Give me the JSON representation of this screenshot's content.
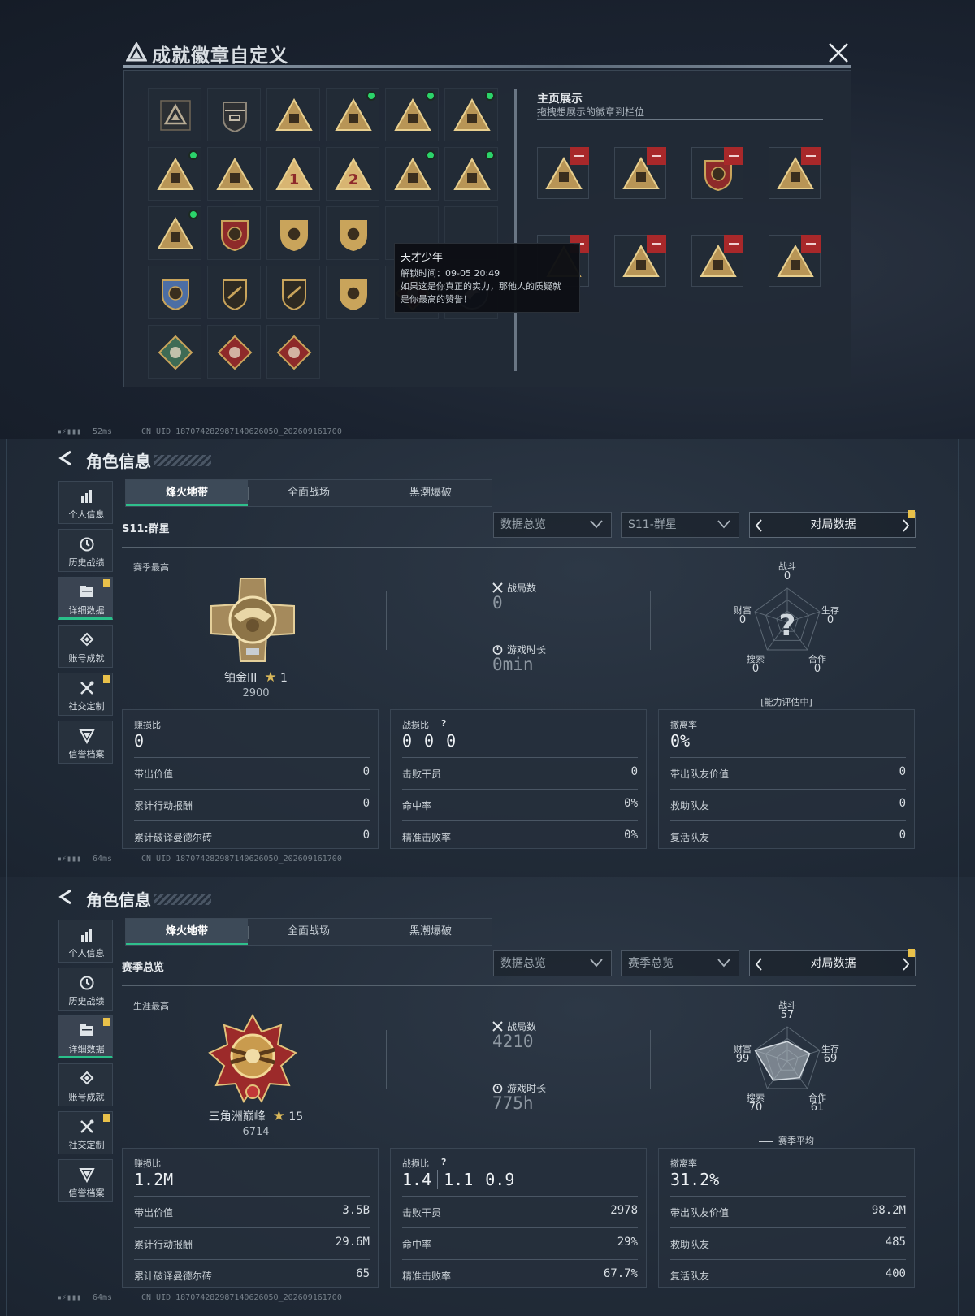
{
  "badge_dialog": {
    "title": "成就徽章自定义",
    "homepage_title": "主页展示",
    "homepage_subtitle": "拖拽想展示的徽章到栏位",
    "badges": [
      {
        "icon": "triangle-logo-icon",
        "new": false
      },
      {
        "icon": "helicopter-badge-icon",
        "new": false
      },
      {
        "icon": "tower-badge-icon",
        "new": false
      },
      {
        "icon": "number-58-badge-icon",
        "new": true
      },
      {
        "icon": "tank-badge-icon",
        "new": true
      },
      {
        "icon": "soldier-badge-icon",
        "new": true
      },
      {
        "icon": "globe-badge-icon",
        "new": true
      },
      {
        "icon": "ship-badge-icon",
        "new": false
      },
      {
        "icon": "number-1-badge-icon",
        "new": false
      },
      {
        "icon": "number-2-badge-icon",
        "new": false
      },
      {
        "icon": "building-badge-icon",
        "new": true
      },
      {
        "icon": "shield-badge-icon",
        "new": true
      },
      {
        "icon": "hands-badge-icon",
        "new": true
      },
      {
        "icon": "star-wreath-badge-icon",
        "new": false
      },
      {
        "icon": "shield-emblem-icon",
        "new": false
      },
      {
        "icon": "tall-crest-icon",
        "new": false
      },
      {
        "icon": "tooltip-hidden",
        "new": false
      },
      {
        "icon": "hidden",
        "new": false
      },
      {
        "icon": "blue-crest-icon",
        "new": false
      },
      {
        "icon": "rifle-shield-icon",
        "new": false
      },
      {
        "icon": "pistol-shield-icon",
        "new": false
      },
      {
        "icon": "gold-crest-icon",
        "new": false
      },
      {
        "icon": "wolf-diamond-icon",
        "new": false
      },
      {
        "icon": "dragon-circle-icon",
        "new": false
      },
      {
        "icon": "green-beast-icon",
        "new": false
      },
      {
        "icon": "red-dragon-icon",
        "new": false
      },
      {
        "icon": "runner-diamond-icon",
        "new": false
      }
    ],
    "slots": [
      "hands-badge-icon",
      "soldier-badge-icon",
      "star-crest-icon",
      "building-badge-icon",
      "hidden-slot-icon",
      "tank-badge-icon",
      "soldier-badge-icon",
      "globe-badge-icon"
    ],
    "tooltip": {
      "name": "天才少年",
      "unlock": "解锁时间：09-05 20:49",
      "desc1": "如果这是你真正的实力，那他人的质疑就",
      "desc2": "是你最高的赞誉！"
    },
    "status": {
      "ms": "52ms",
      "uid": "CN UID 18707428298714062605O_202609161700"
    }
  },
  "panels": [
    {
      "header_title": "角色信息",
      "sidebar": [
        {
          "label": "个人信息",
          "icon": "bar-chart-icon",
          "flag": false,
          "active": false
        },
        {
          "label": "历史战绩",
          "icon": "clock-icon",
          "flag": false,
          "active": false
        },
        {
          "label": "详细数据",
          "icon": "folder-icon",
          "flag": true,
          "active": true
        },
        {
          "label": "账号成就",
          "icon": "medal-icon",
          "flag": false,
          "active": false
        },
        {
          "label": "社交定制",
          "icon": "tools-icon",
          "flag": true,
          "active": false
        },
        {
          "label": "信誉档案",
          "icon": "shield-icon",
          "flag": false,
          "active": false
        }
      ],
      "tabs": [
        "烽火地带",
        "全面战场",
        "黑潮爆破"
      ],
      "season_label": "S11:群星",
      "dropdown1": "数据总览",
      "dropdown2": "S11-群星",
      "match_button": "对局数据",
      "best_label": "赛季最高",
      "rank_name": "铂金III",
      "rank_stars": "1",
      "rank_score": "2900",
      "matches_label": "战局数",
      "matches_value": "0",
      "playtime_label": "游戏时长",
      "playtime_value": "0min",
      "radar": {
        "combat_label": "战斗",
        "combat": "0",
        "survival_label": "生存",
        "survival": "0",
        "coop_label": "合作",
        "coop": "0",
        "search_label": "搜索",
        "search": "0",
        "wealth_label": "财富",
        "wealth": "0",
        "values": [
          0,
          0,
          0,
          0,
          0
        ],
        "center": "?",
        "note": "[能力评估中]"
      },
      "card1": {
        "label": "赚损比",
        "big": "0",
        "rows": [
          [
            "带出价值",
            "0"
          ],
          [
            "累计行动报酬",
            "0"
          ],
          [
            "累计破译曼德尔砖",
            "0"
          ]
        ]
      },
      "card2": {
        "label": "战损比",
        "q": "?",
        "kd": [
          "0",
          "0",
          "0"
        ],
        "rows": [
          [
            "击败干员",
            "0"
          ],
          [
            "命中率",
            "0%"
          ],
          [
            "精准击败率",
            "0%"
          ]
        ]
      },
      "card3": {
        "label": "撤离率",
        "big": "0%",
        "rows": [
          [
            "带出队友价值",
            "0"
          ],
          [
            "救助队友",
            "0"
          ],
          [
            "复活队友",
            "0"
          ]
        ]
      },
      "status": {
        "ms": "64ms",
        "uid": "CN UID 18707428298714062605O_202609161700"
      }
    },
    {
      "header_title": "角色信息",
      "sidebar": [
        {
          "label": "个人信息",
          "icon": "bar-chart-icon",
          "flag": false,
          "active": false
        },
        {
          "label": "历史战绩",
          "icon": "clock-icon",
          "flag": false,
          "active": false
        },
        {
          "label": "详细数据",
          "icon": "folder-icon",
          "flag": true,
          "active": true
        },
        {
          "label": "账号成就",
          "icon": "medal-icon",
          "flag": false,
          "active": false
        },
        {
          "label": "社交定制",
          "icon": "tools-icon",
          "flag": true,
          "active": false
        },
        {
          "label": "信誉档案",
          "icon": "shield-icon",
          "flag": false,
          "active": false
        }
      ],
      "tabs": [
        "烽火地带",
        "全面战场",
        "黑潮爆破"
      ],
      "season_label": "赛季总览",
      "dropdown1": "数据总览",
      "dropdown2": "赛季总览",
      "match_button": "对局数据",
      "best_label": "生涯最高",
      "rank_name": "三角洲巅峰",
      "rank_stars": "15",
      "rank_score": "6714",
      "matches_label": "战局数",
      "matches_value": "4210",
      "playtime_label": "游戏时长",
      "playtime_value": "775h",
      "radar": {
        "combat_label": "战斗",
        "combat": "57",
        "survival_label": "生存",
        "survival": "69",
        "coop_label": "合作",
        "coop": "61",
        "search_label": "搜索",
        "search": "70",
        "wealth_label": "财富",
        "wealth": "99",
        "values": [
          57,
          69,
          61,
          70,
          99
        ],
        "center": "",
        "note": "赛季平均"
      },
      "card1": {
        "label": "赚损比",
        "big": "1.2M",
        "rows": [
          [
            "带出价值",
            "3.5B"
          ],
          [
            "累计行动报酬",
            "29.6M"
          ],
          [
            "累计破译曼德尔砖",
            "65"
          ]
        ]
      },
      "card2": {
        "label": "战损比",
        "q": "?",
        "kd": [
          "1.4",
          "1.1",
          "0.9"
        ],
        "rows": [
          [
            "击败干员",
            "2978"
          ],
          [
            "命中率",
            "29%"
          ],
          [
            "精准击败率",
            "67.7%"
          ]
        ]
      },
      "card3": {
        "label": "撤离率",
        "big": "31.2%",
        "rows": [
          [
            "带出队友价值",
            "98.2M"
          ],
          [
            "救助队友",
            "485"
          ],
          [
            "复活队友",
            "400"
          ]
        ]
      },
      "status": {
        "ms": "64ms",
        "uid": "CN UID 18707428298714062605O_202609161700"
      }
    }
  ]
}
